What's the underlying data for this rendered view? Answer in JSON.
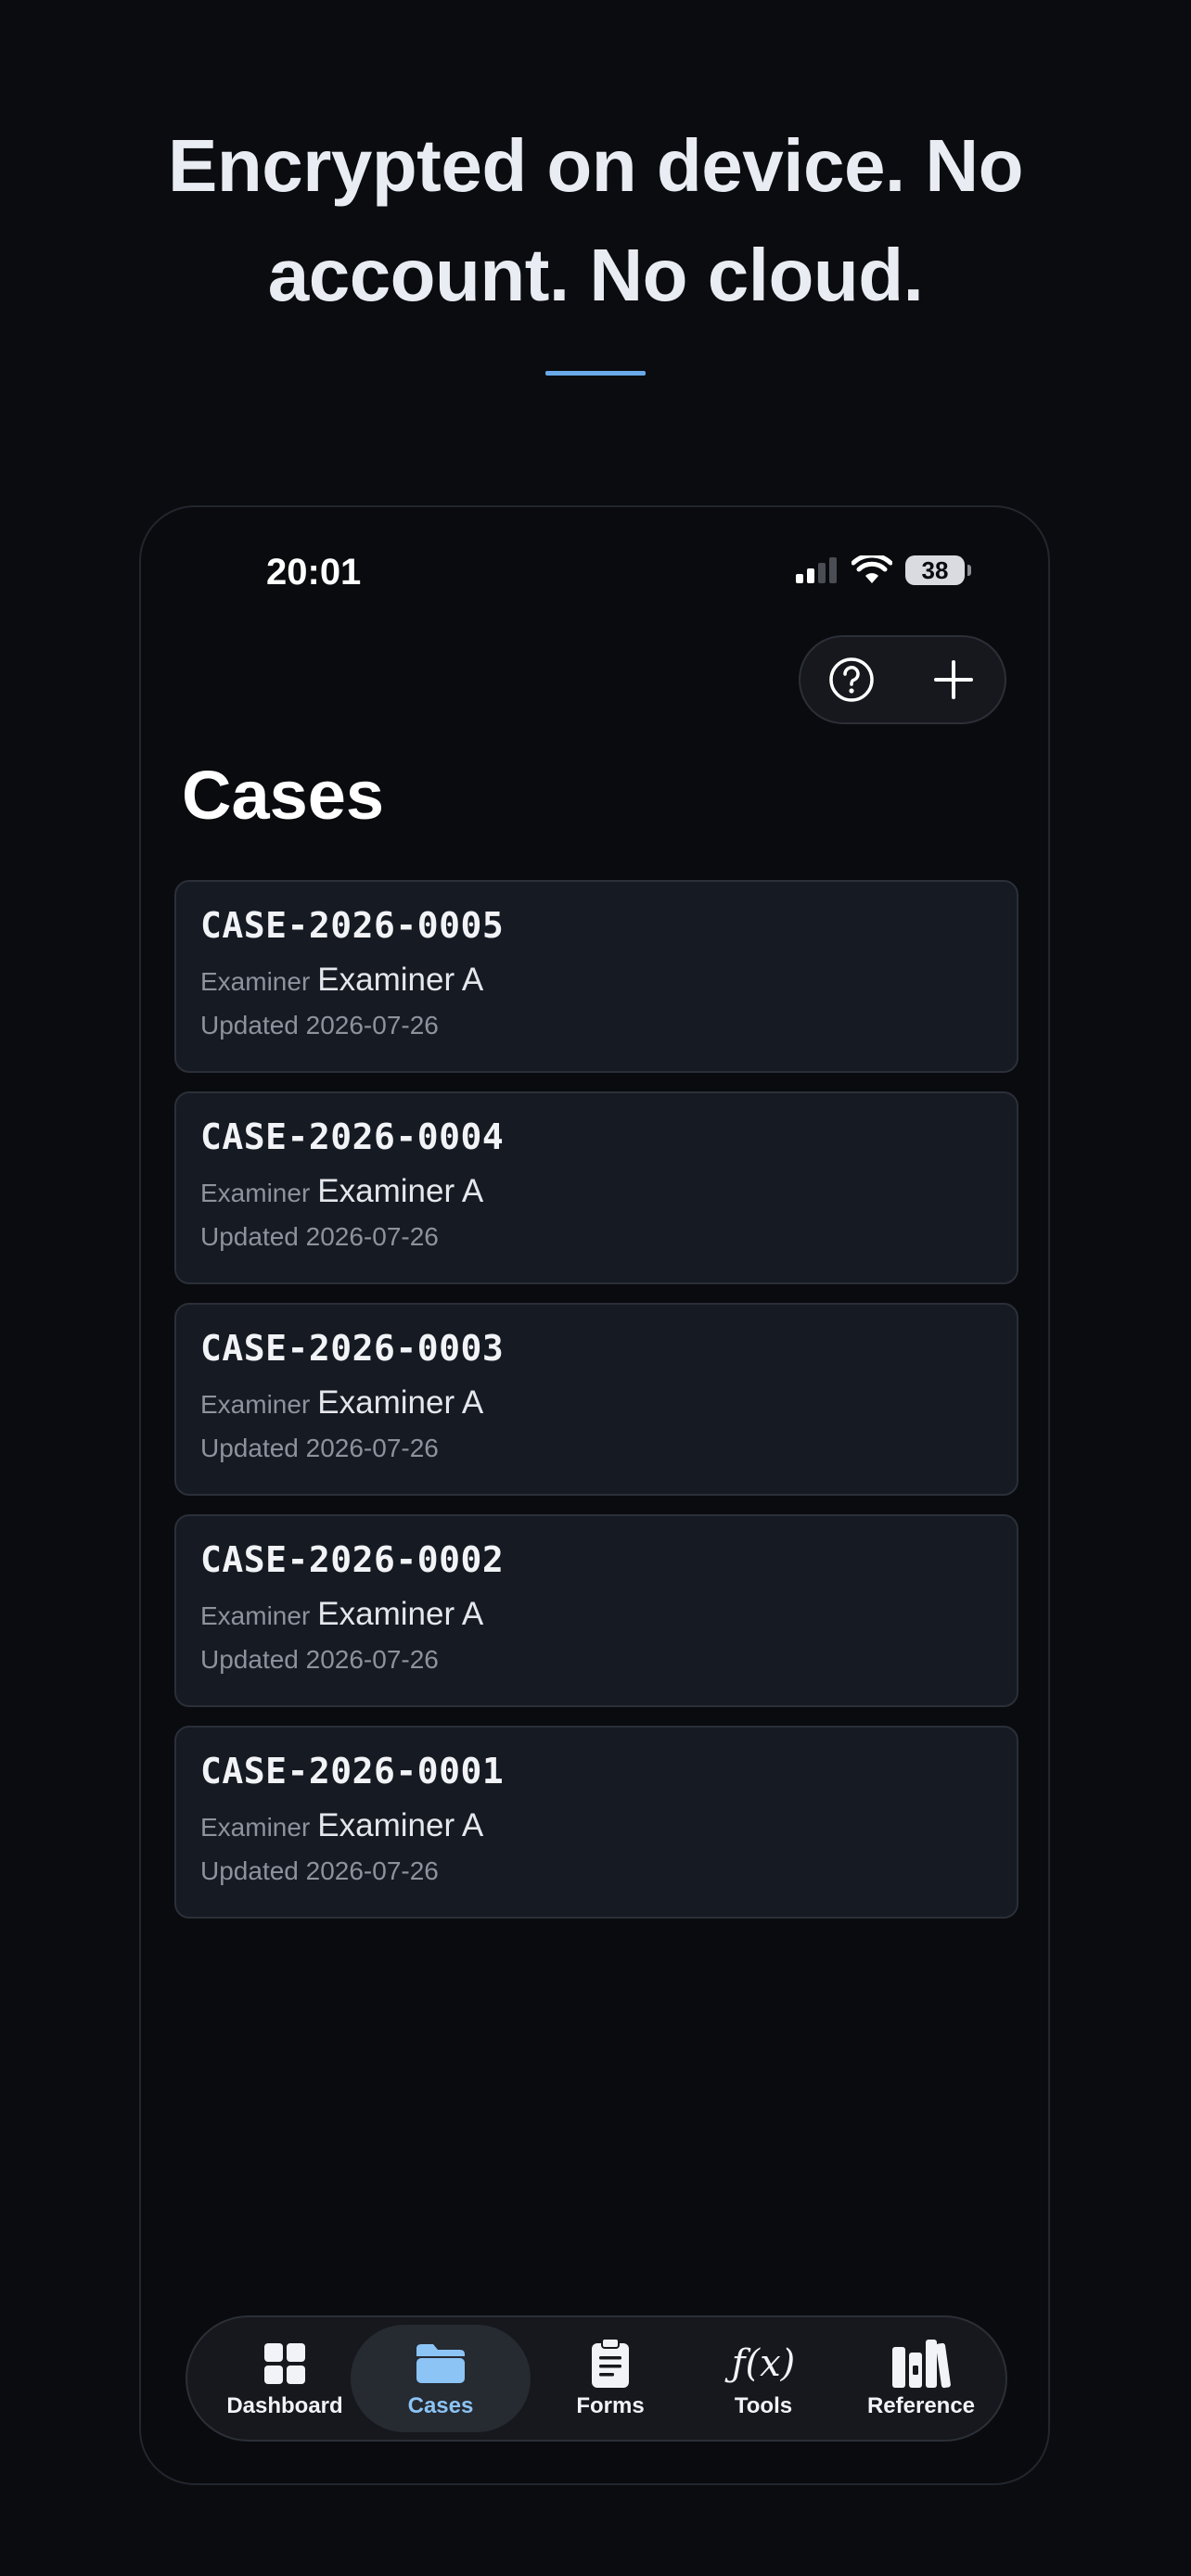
{
  "headline": {
    "line1": "Encrypted on device. No",
    "line2": "account. No cloud."
  },
  "status_bar": {
    "time": "20:01",
    "battery": "38"
  },
  "screen_title": "Cases",
  "cases": [
    {
      "id": "CASE-2026-0005",
      "examiner_label": "Examiner",
      "examiner": "Examiner A",
      "updated": "Updated 2026-07-26"
    },
    {
      "id": "CASE-2026-0004",
      "examiner_label": "Examiner",
      "examiner": "Examiner A",
      "updated": "Updated 2026-07-26"
    },
    {
      "id": "CASE-2026-0003",
      "examiner_label": "Examiner",
      "examiner": "Examiner A",
      "updated": "Updated 2026-07-26"
    },
    {
      "id": "CASE-2026-0002",
      "examiner_label": "Examiner",
      "examiner": "Examiner A",
      "updated": "Updated 2026-07-26"
    },
    {
      "id": "CASE-2026-0001",
      "examiner_label": "Examiner",
      "examiner": "Examiner A",
      "updated": "Updated 2026-07-26"
    }
  ],
  "actions": {
    "help_icon": "question-circle-icon",
    "add_icon": "plus-icon"
  },
  "tabs": [
    {
      "label": "Dashboard",
      "icon": "grid-icon",
      "active": false
    },
    {
      "label": "Cases",
      "icon": "folder-icon",
      "active": true
    },
    {
      "label": "Forms",
      "icon": "clipboard-icon",
      "active": false
    },
    {
      "label": "Tools",
      "icon": "function-icon",
      "active": false,
      "glyph": "ƒ(x)"
    },
    {
      "label": "Reference",
      "icon": "books-icon",
      "active": false
    }
  ],
  "colors": {
    "background": "#0a0c10",
    "accent": "#6aa9e8",
    "active_tab": "#8cc4f5",
    "card": "#161a22"
  }
}
